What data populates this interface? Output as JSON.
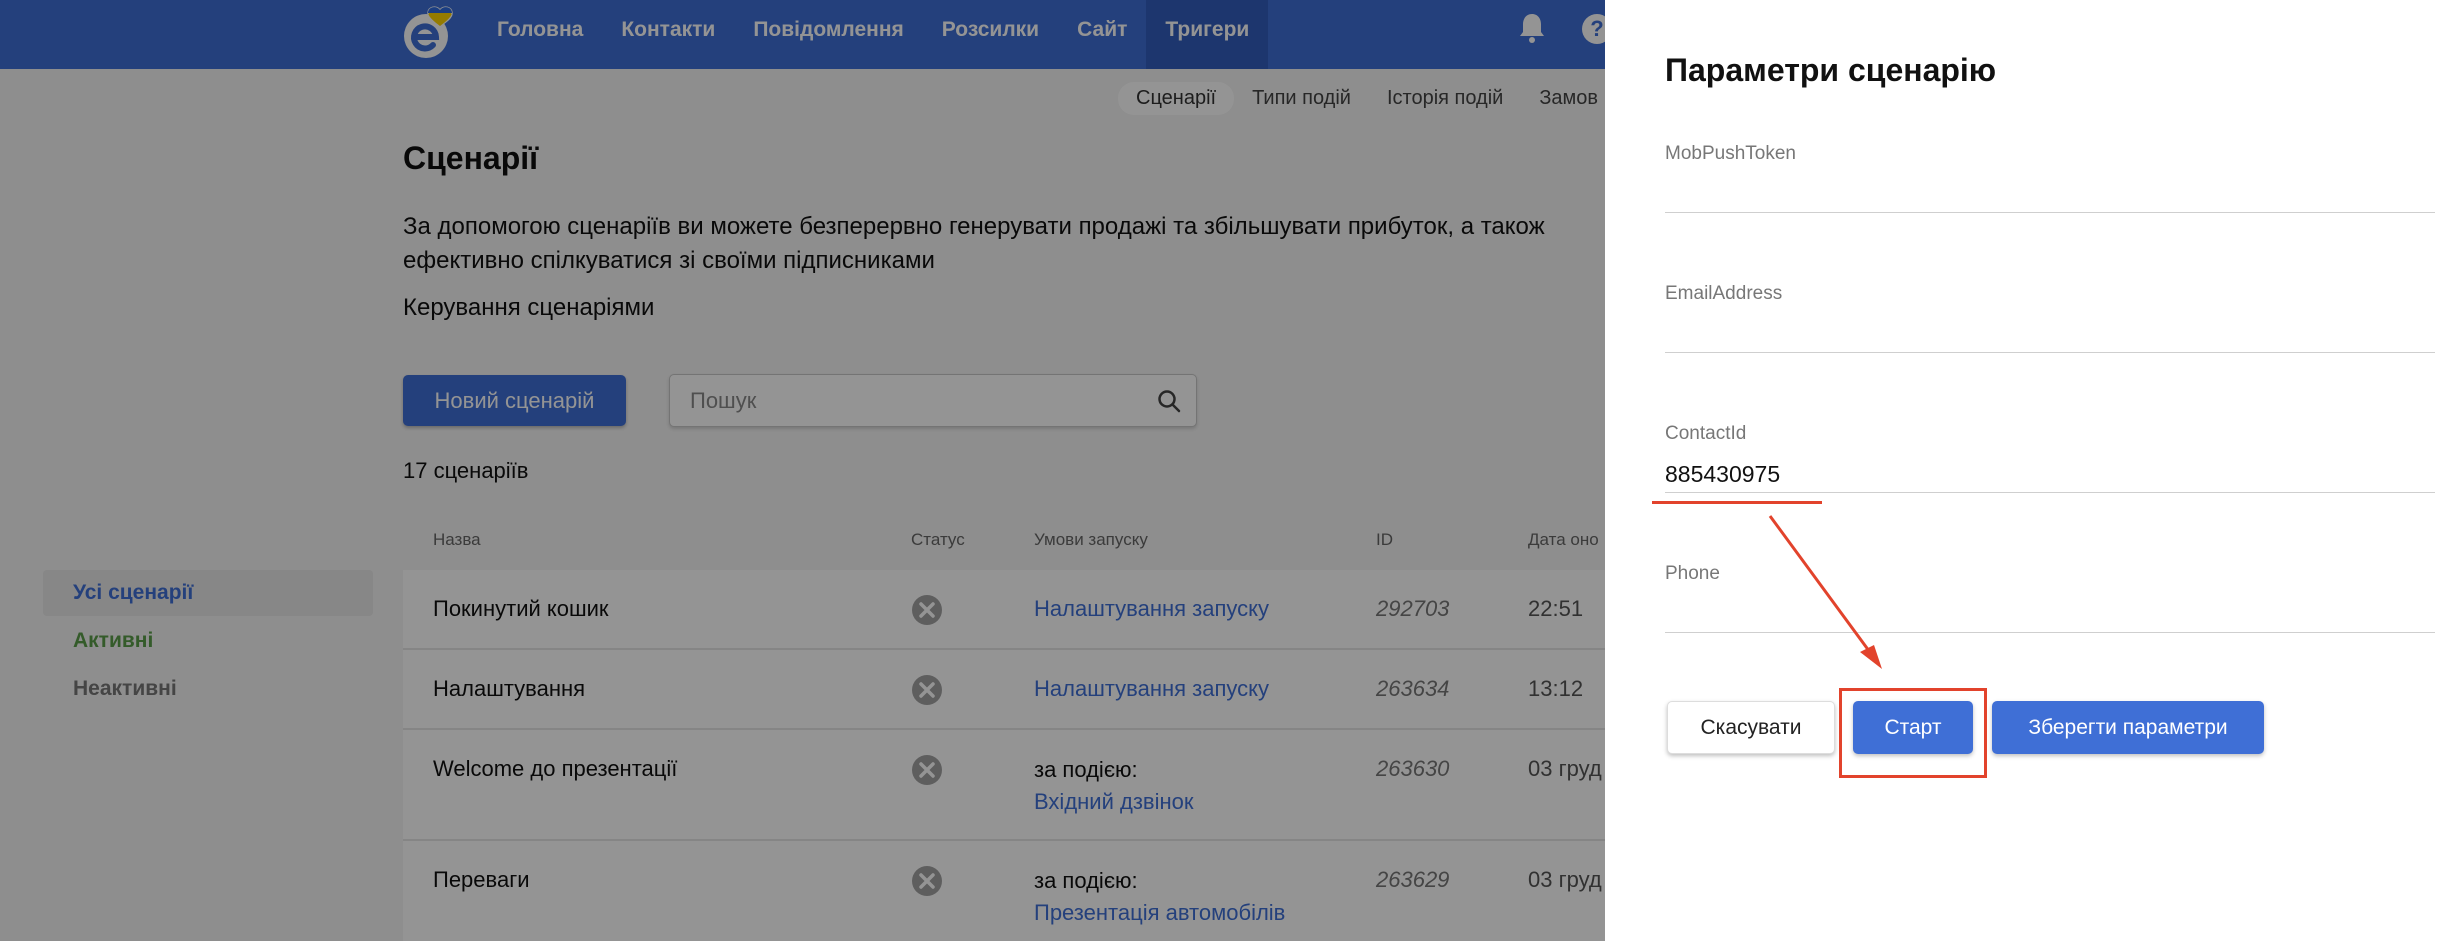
{
  "colors": {
    "brand": "#3f6fd6",
    "annotation": "#e2432c",
    "active_green": "#5a9e49"
  },
  "header": {
    "nav": [
      "Головна",
      "Контакти",
      "Повідомлення",
      "Розсилки",
      "Сайт",
      "Тригери"
    ],
    "active_nav": "Тригери",
    "icons": [
      "logo",
      "bell-icon",
      "help-icon"
    ],
    "help_label": "?"
  },
  "subtabs": [
    "Сценарії",
    "Типи подій",
    "Історія подій",
    "Замов"
  ],
  "page": {
    "title": "Сценарії",
    "description": "За допомогою сценаріїв ви можете безперервно генерувати продажі та збільшувати прибуток, а також ефективно спілкуватися зі своїми підписниками",
    "manage_link": "Керування сценаріями",
    "new_button": "Новий сценарій",
    "search_placeholder": "Пошук",
    "count": "17 сценаріїв"
  },
  "sidebar": [
    "Усі сценарії",
    "Активні",
    "Неактивні"
  ],
  "table": {
    "columns": [
      "Назва",
      "Статус",
      "Умови запуску",
      "ID",
      "Дата оно"
    ],
    "rows": [
      {
        "name": "Покинутий кошик",
        "condition": "Налаштування запуску",
        "event_prefix": "",
        "id": "292703",
        "date": "22:51"
      },
      {
        "name": "Налаштування",
        "condition": "Налаштування запуску",
        "event_prefix": "",
        "id": "263634",
        "date": "13:12"
      },
      {
        "name": "Welcome до презентації",
        "condition": "Вхідний дзвінок",
        "event_prefix": "за подією:",
        "id": "263630",
        "date": "03 груд"
      },
      {
        "name": "Переваги",
        "condition": "Презентація автомобілів",
        "event_prefix": "за подією:",
        "id": "263629",
        "date": "03 груд"
      }
    ]
  },
  "panel": {
    "title": "Параметри сценарію",
    "fields": [
      {
        "label": "MobPushToken",
        "value": ""
      },
      {
        "label": "EmailAddress",
        "value": ""
      },
      {
        "label": "ContactId",
        "value": "885430975"
      },
      {
        "label": "Phone",
        "value": ""
      }
    ],
    "buttons": {
      "cancel": "Скасувати",
      "start": "Старт",
      "save": "Зберегти параметри"
    }
  }
}
